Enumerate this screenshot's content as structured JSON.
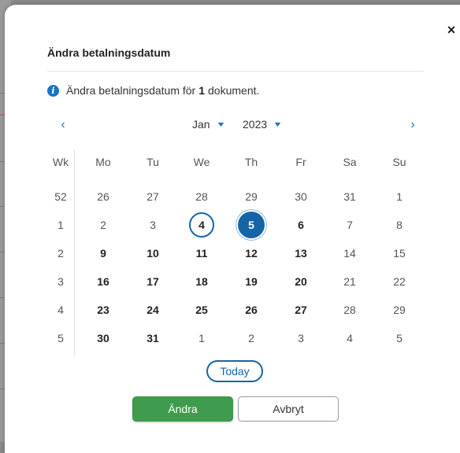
{
  "dialog": {
    "title": "Ändra betalningsdatum",
    "close_label": "×",
    "info_prefix": "Ändra betalningsdatum för",
    "info_count": "1",
    "info_suffix": "dokument."
  },
  "calendar": {
    "prev_icon": "‹",
    "next_icon": "›",
    "month": "Jan",
    "year": "2023",
    "headers": [
      "Wk",
      "Mo",
      "Tu",
      "We",
      "Th",
      "Fr",
      "Sa",
      "Su"
    ],
    "weeks": [
      {
        "wk": "52",
        "days": [
          {
            "d": "26",
            "s": "muted"
          },
          {
            "d": "27",
            "s": "muted"
          },
          {
            "d": "28",
            "s": "muted"
          },
          {
            "d": "29",
            "s": "muted"
          },
          {
            "d": "30",
            "s": "muted"
          },
          {
            "d": "31",
            "s": "muted"
          },
          {
            "d": "1",
            "s": "muted"
          }
        ]
      },
      {
        "wk": "1",
        "days": [
          {
            "d": "2",
            "s": "muted"
          },
          {
            "d": "3",
            "s": "muted"
          },
          {
            "d": "4",
            "s": "today"
          },
          {
            "d": "5",
            "s": "selected"
          },
          {
            "d": "6",
            "s": "bold"
          },
          {
            "d": "7",
            "s": "muted"
          },
          {
            "d": "8",
            "s": "muted"
          }
        ]
      },
      {
        "wk": "2",
        "days": [
          {
            "d": "9",
            "s": "bold"
          },
          {
            "d": "10",
            "s": "bold"
          },
          {
            "d": "11",
            "s": "bold"
          },
          {
            "d": "12",
            "s": "bold"
          },
          {
            "d": "13",
            "s": "bold"
          },
          {
            "d": "14",
            "s": "muted"
          },
          {
            "d": "15",
            "s": "muted"
          }
        ]
      },
      {
        "wk": "3",
        "days": [
          {
            "d": "16",
            "s": "bold"
          },
          {
            "d": "17",
            "s": "bold"
          },
          {
            "d": "18",
            "s": "bold"
          },
          {
            "d": "19",
            "s": "bold"
          },
          {
            "d": "20",
            "s": "bold"
          },
          {
            "d": "21",
            "s": "muted"
          },
          {
            "d": "22",
            "s": "muted"
          }
        ]
      },
      {
        "wk": "4",
        "days": [
          {
            "d": "23",
            "s": "bold"
          },
          {
            "d": "24",
            "s": "bold"
          },
          {
            "d": "25",
            "s": "bold"
          },
          {
            "d": "26",
            "s": "bold"
          },
          {
            "d": "27",
            "s": "bold"
          },
          {
            "d": "28",
            "s": "muted"
          },
          {
            "d": "29",
            "s": "muted"
          }
        ]
      },
      {
        "wk": "5",
        "days": [
          {
            "d": "30",
            "s": "bold"
          },
          {
            "d": "31",
            "s": "bold"
          },
          {
            "d": "1",
            "s": "muted"
          },
          {
            "d": "2",
            "s": "muted"
          },
          {
            "d": "3",
            "s": "muted"
          },
          {
            "d": "4",
            "s": "muted"
          },
          {
            "d": "5",
            "s": "muted"
          }
        ]
      }
    ]
  },
  "buttons": {
    "today": "Today",
    "confirm": "Ändra",
    "cancel": "Avbryt"
  },
  "colors": {
    "accent": "#1565a6",
    "primary_button": "#3f9b4d"
  }
}
